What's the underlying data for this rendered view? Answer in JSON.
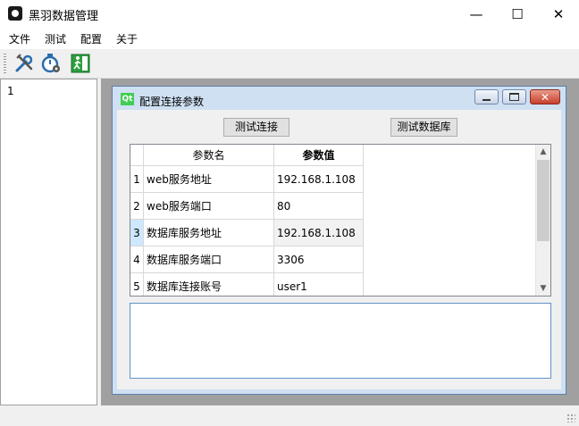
{
  "window": {
    "title": "黑羽数据管理",
    "controls": {
      "minimize": "—",
      "maximize": "☐",
      "close": "✕"
    }
  },
  "menu": [
    "文件",
    "测试",
    "配置",
    "关于"
  ],
  "toolbar": {
    "icons": [
      "tools-icon",
      "settings-stopwatch-icon",
      "exit-icon"
    ]
  },
  "tree": {
    "items": [
      "1"
    ]
  },
  "subwindow": {
    "title": "配置连接参数",
    "icon_label": "Qt",
    "buttons": {
      "test_connection": "测试连接",
      "test_database": "测试数据库"
    },
    "table": {
      "headers": [
        "参数名",
        "参数值"
      ],
      "rows": [
        {
          "num": "1",
          "name": "web服务地址",
          "value": "192.168.1.108"
        },
        {
          "num": "2",
          "name": "web服务端口",
          "value": "80"
        },
        {
          "num": "3",
          "name": "数据库服务地址",
          "value": "192.168.1.108"
        },
        {
          "num": "4",
          "name": "数据库服务端口",
          "value": "3306"
        },
        {
          "num": "5",
          "name": "数据库连接账号",
          "value": "user1"
        }
      ]
    },
    "log_text": ""
  },
  "colors": {
    "accent": "#cde8ff",
    "mdi_background": "#a0a0a0",
    "subwindow_frame": "#cfe0f3"
  }
}
